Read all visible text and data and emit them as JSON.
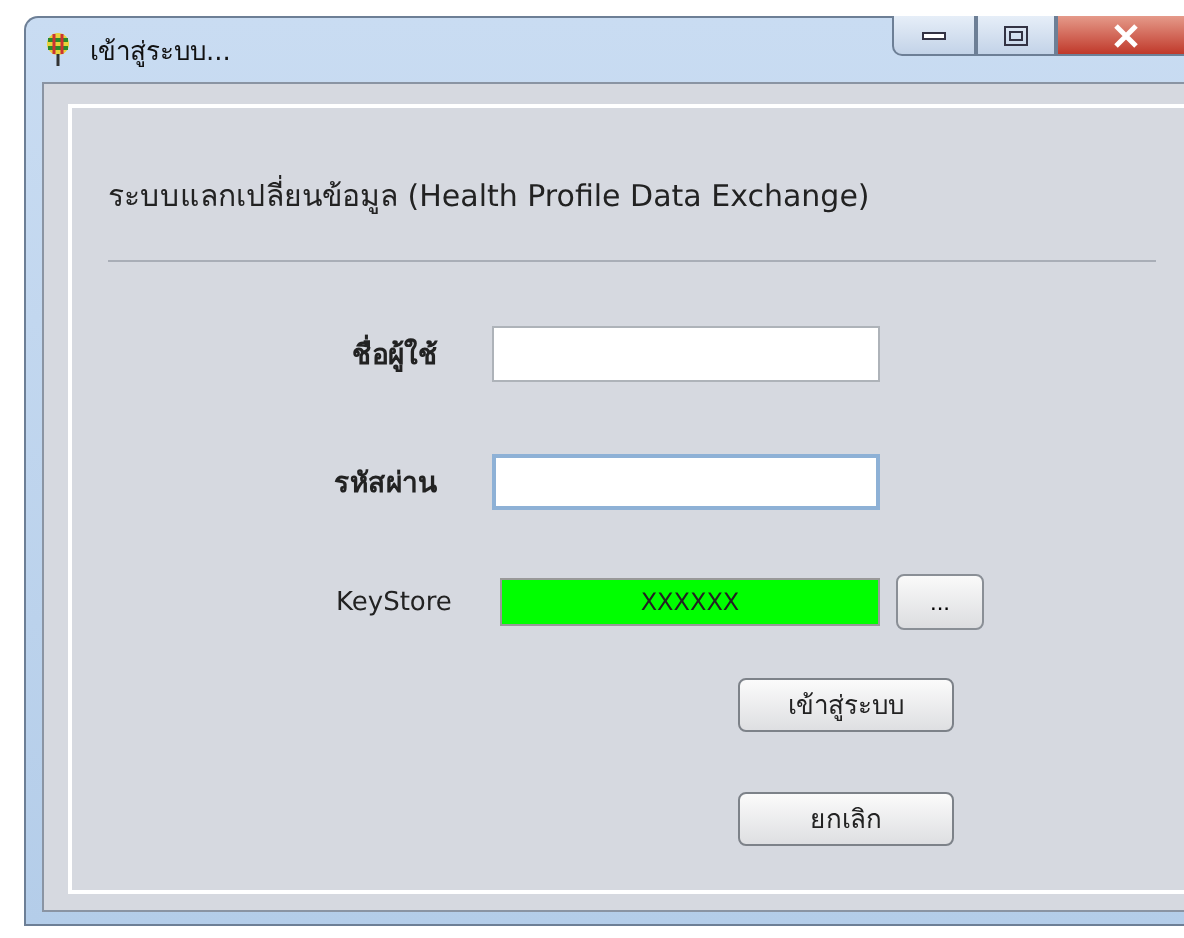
{
  "window": {
    "title": "เข้าสู่ระบบ..."
  },
  "heading": "ระบบแลกเปลี่ยนข้อมูล (Health Profile Data Exchange)",
  "fields": [
    {
      "kind": "text",
      "label": "ชื่อผู้ใช้",
      "focused": false
    },
    {
      "kind": "password",
      "label": "รหัสผ่าน",
      "focused": true
    },
    {
      "kind": "keystore",
      "label": "KeyStore",
      "value": "XXXXXX",
      "color": "#00ff00",
      "browse": "..."
    }
  ],
  "buttons": [
    "เข้าสู่ระบบ",
    "ยกเลิก"
  ]
}
